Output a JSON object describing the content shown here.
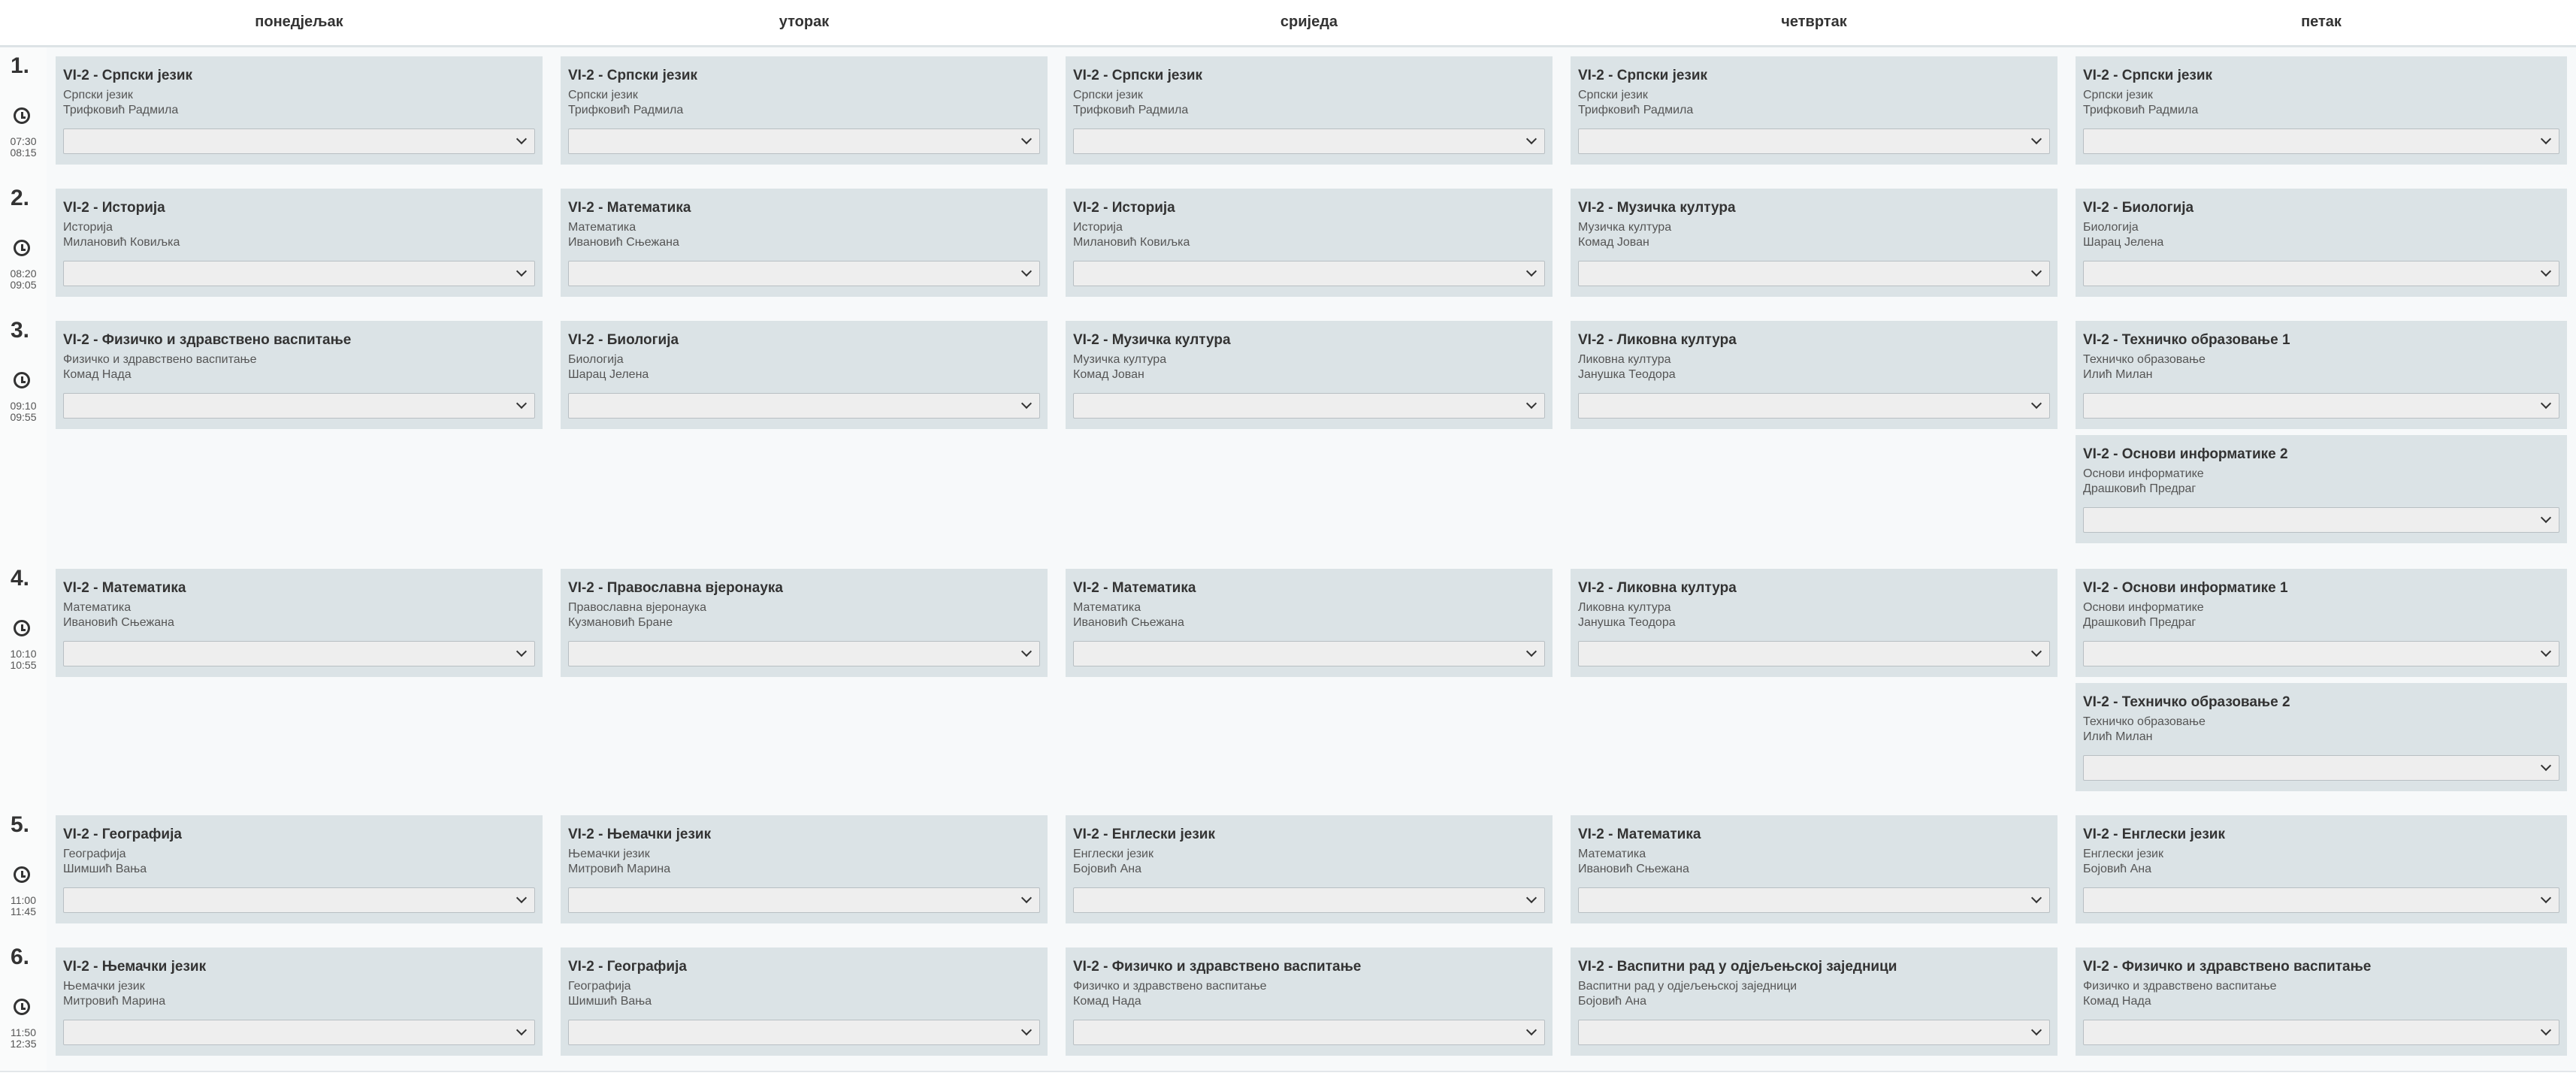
{
  "days": [
    "понедјељак",
    "уторак",
    "сриједа",
    "четвртак",
    "петак"
  ],
  "periods": [
    {
      "num": "1.",
      "start": "07:30",
      "end": "08:15",
      "cells": [
        [
          {
            "title": "VI-2 - Српски језик",
            "subject": "Српски језик",
            "teacher": "Трифковић Радмила"
          }
        ],
        [
          {
            "title": "VI-2 - Српски језик",
            "subject": "Српски језик",
            "teacher": "Трифковић Радмила"
          }
        ],
        [
          {
            "title": "VI-2 - Српски језик",
            "subject": "Српски језик",
            "teacher": "Трифковић Радмила"
          }
        ],
        [
          {
            "title": "VI-2 - Српски језик",
            "subject": "Српски језик",
            "teacher": "Трифковић Радмила"
          }
        ],
        [
          {
            "title": "VI-2 - Српски језик",
            "subject": "Српски језик",
            "teacher": "Трифковић Радмила"
          }
        ]
      ]
    },
    {
      "num": "2.",
      "start": "08:20",
      "end": "09:05",
      "cells": [
        [
          {
            "title": "VI-2 - Историја",
            "subject": "Историја",
            "teacher": "Милановић Ковиљка"
          }
        ],
        [
          {
            "title": "VI-2 - Математика",
            "subject": "Математика",
            "teacher": "Ивановић Сњежана"
          }
        ],
        [
          {
            "title": "VI-2 - Историја",
            "subject": "Историја",
            "teacher": "Милановић Ковиљка"
          }
        ],
        [
          {
            "title": "VI-2 - Музичка култура",
            "subject": "Музичка култура",
            "teacher": "Комад Јован"
          }
        ],
        [
          {
            "title": "VI-2 - Биологија",
            "subject": "Биологија",
            "teacher": "Шарац Јелена"
          }
        ]
      ]
    },
    {
      "num": "3.",
      "start": "09:10",
      "end": "09:55",
      "cells": [
        [
          {
            "title": "VI-2 - Физичко и здравствено васпитање",
            "subject": "Физичко и здравствено васпитање",
            "teacher": "Комад Нада"
          }
        ],
        [
          {
            "title": "VI-2 - Биологија",
            "subject": "Биологија",
            "teacher": "Шарац Јелена"
          }
        ],
        [
          {
            "title": "VI-2 - Музичка култура",
            "subject": "Музичка култура",
            "teacher": "Комад Јован"
          }
        ],
        [
          {
            "title": "VI-2 - Ликовна култура",
            "subject": "Ликовна култура",
            "teacher": "Јанушка Теодора"
          }
        ],
        [
          {
            "title": "VI-2 - Техничко образовање 1",
            "subject": "Техничко образовање",
            "teacher": "Илић Милан"
          },
          {
            "title": "VI-2 - Основи информатике 2",
            "subject": "Основи информатике",
            "teacher": "Драшковић Предраг"
          }
        ]
      ]
    },
    {
      "num": "4.",
      "start": "10:10",
      "end": "10:55",
      "cells": [
        [
          {
            "title": "VI-2 - Математика",
            "subject": "Математика",
            "teacher": "Ивановић Сњежана"
          }
        ],
        [
          {
            "title": "VI-2 - Православна вјеронаука",
            "subject": "Православна вјеронаука",
            "teacher": "Кузмановић Бране"
          }
        ],
        [
          {
            "title": "VI-2 - Математика",
            "subject": "Математика",
            "teacher": "Ивановић Сњежана"
          }
        ],
        [
          {
            "title": "VI-2 - Ликовна култура",
            "subject": "Ликовна култура",
            "teacher": "Јанушка Теодора"
          }
        ],
        [
          {
            "title": "VI-2 - Основи информатике 1",
            "subject": "Основи информатике",
            "teacher": "Драшковић Предраг"
          },
          {
            "title": "VI-2 - Техничко образовање 2",
            "subject": "Техничко образовање",
            "teacher": "Илић Милан"
          }
        ]
      ]
    },
    {
      "num": "5.",
      "start": "11:00",
      "end": "11:45",
      "cells": [
        [
          {
            "title": "VI-2 - Географија",
            "subject": "Географија",
            "teacher": "Шимшић Вања"
          }
        ],
        [
          {
            "title": "VI-2 - Њемачки језик",
            "subject": "Њемачки језик",
            "teacher": "Митровић Марина"
          }
        ],
        [
          {
            "title": "VI-2 - Енглески језик",
            "subject": "Енглески језик",
            "teacher": "Бојовић Ана"
          }
        ],
        [
          {
            "title": "VI-2 - Математика",
            "subject": "Математика",
            "teacher": "Ивановић Сњежана"
          }
        ],
        [
          {
            "title": "VI-2 - Енглески језик",
            "subject": "Енглески језик",
            "teacher": "Бојовић Ана"
          }
        ]
      ]
    },
    {
      "num": "6.",
      "start": "11:50",
      "end": "12:35",
      "cells": [
        [
          {
            "title": "VI-2 - Њемачки језик",
            "subject": "Њемачки језик",
            "teacher": "Митровић Марина"
          }
        ],
        [
          {
            "title": "VI-2 - Географија",
            "subject": "Географија",
            "teacher": "Шимшић Вања"
          }
        ],
        [
          {
            "title": "VI-2 - Физичко и здравствено васпитање",
            "subject": "Физичко и здравствено васпитање",
            "teacher": "Комад Нада"
          }
        ],
        [
          {
            "title": "VI-2 - Васпитни рад у одјељењској заједници",
            "subject": "Васпитни рад у одјељењској заједници",
            "teacher": "Бојовић Ана"
          }
        ],
        [
          {
            "title": "VI-2 - Физичко и здравствено васпитање",
            "subject": "Физичко и здравствено васпитање",
            "teacher": "Комад Нада"
          }
        ]
      ]
    }
  ]
}
